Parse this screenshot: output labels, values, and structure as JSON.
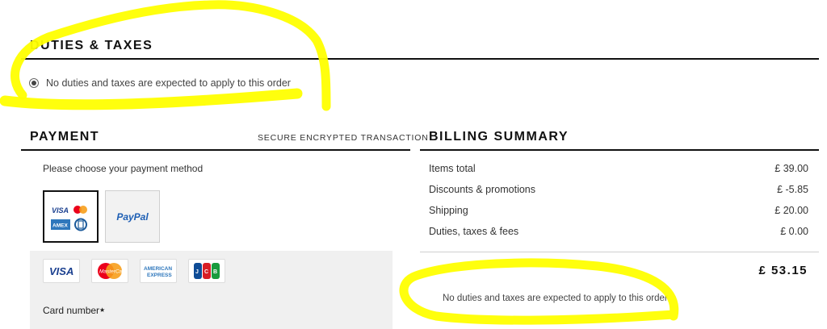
{
  "duties": {
    "title": "DUTIES & TAXES",
    "option_label": "No duties and taxes are expected to apply to this order"
  },
  "payment": {
    "title": "PAYMENT",
    "secure_label": "SECURE ENCRYPTED TRANSACTION",
    "choose_label": "Please choose your payment method",
    "methods": [
      {
        "name": "Card",
        "logos": [
          "VISA",
          "MasterCard",
          "AMEX",
          "Diners"
        ],
        "selected": true
      },
      {
        "name": "PayPal",
        "label": "PayPal",
        "selected": false
      }
    ],
    "card_logos": [
      "VISA",
      "MasterCard",
      "AMERICAN EXPRESS",
      "JCB"
    ],
    "card_number_label": "Card number",
    "required_marker": "★"
  },
  "billing": {
    "title": "BILLING SUMMARY",
    "rows": [
      {
        "label": "Items total",
        "value": "£ 39.00"
      },
      {
        "label": "Discounts & promotions",
        "value": "£ -5.85"
      },
      {
        "label": "Shipping",
        "value": "£ 20.00"
      },
      {
        "label": "Duties, taxes & fees",
        "value": "£ 0.00"
      }
    ],
    "total": "£ 53.15",
    "duties_note": "No duties and taxes are expected to apply to this order"
  },
  "colors": {
    "highlight": "#ffff00",
    "rule": "#111111",
    "panel": "#f0f0f0",
    "paypal_blue": "#1e5fb4"
  }
}
